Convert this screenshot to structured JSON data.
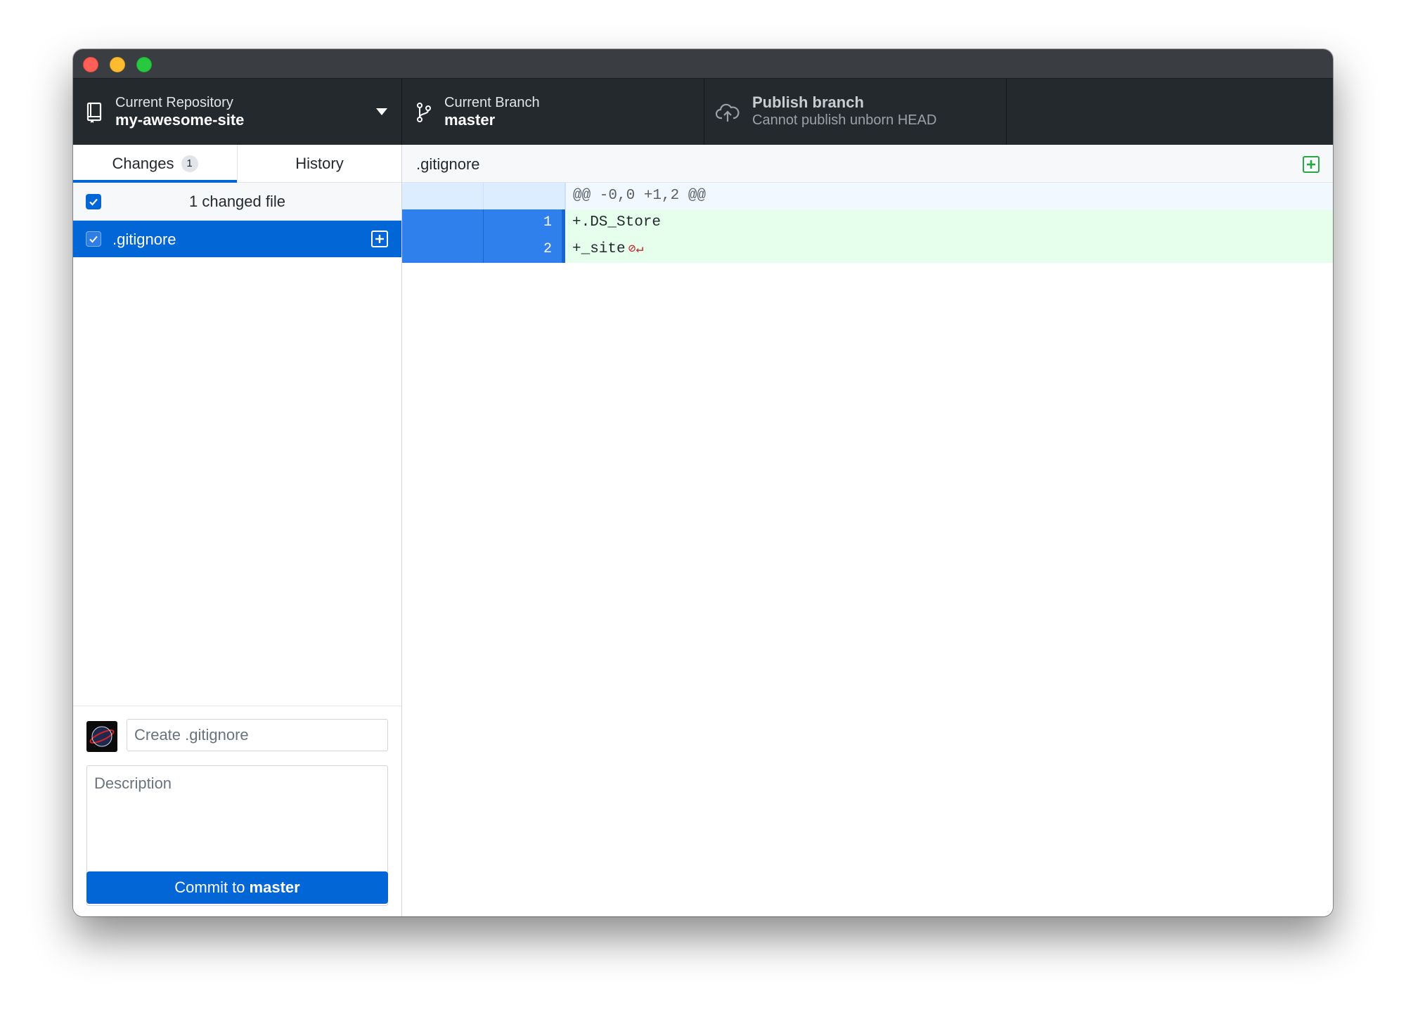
{
  "toolbar": {
    "repository": {
      "label": "Current Repository",
      "value": "my-awesome-site"
    },
    "branch": {
      "label": "Current Branch",
      "value": "master"
    },
    "publish": {
      "label": "Publish branch",
      "value": "Cannot publish unborn HEAD"
    }
  },
  "sidebar": {
    "tabs": [
      {
        "label": "Changes",
        "count": "1"
      },
      {
        "label": "History"
      }
    ],
    "changes_header": "1 changed file",
    "files": [
      {
        "name": ".gitignore",
        "status": "added"
      }
    ]
  },
  "commit": {
    "summary_placeholder": "Create .gitignore",
    "description_placeholder": "Description",
    "button_prefix": "Commit to",
    "button_branch": "master"
  },
  "diff": {
    "file": ".gitignore",
    "hunk_header": "@@ -0,0 +1,2 @@",
    "lines": [
      {
        "new": "1",
        "text": "+.DS_Store"
      },
      {
        "new": "2",
        "text": "+_site"
      }
    ]
  },
  "colors": {
    "accent": "#0366d6",
    "toolbar_bg": "#24292e",
    "added_bg": "#e6ffed",
    "added_icon": "#28a745"
  }
}
